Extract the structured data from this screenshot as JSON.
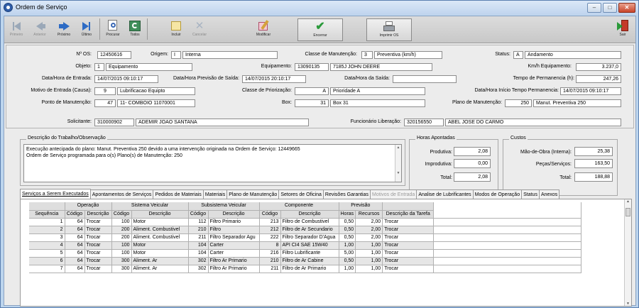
{
  "window": {
    "title": "Ordem de Serviço"
  },
  "toolbar": {
    "primeiro": "Primeiro",
    "anterior": "Anterior",
    "proximo": "Próximo",
    "ultimo": "Último",
    "procurar": "Procurar",
    "todos": "Todos",
    "incluir": "Incluir",
    "cancelar": "Cancelar",
    "modificar": "Modificar",
    "encerrar": "Encerrar",
    "imprimir": "Imprimir OS",
    "sair": "Sair"
  },
  "form": {
    "nos_label": "Nº OS:",
    "nos": "12450616",
    "origem_label": "Origem:",
    "origem_code": "I",
    "origem": "Interna",
    "classe_label": "Classe de Manutenção:",
    "classe_code": "3",
    "classe": "Preventiva (km/h)",
    "status_label": "Status:",
    "status_code": "A",
    "status": "Andamento",
    "objeto_label": "Objeto:",
    "objeto_code": "1",
    "objeto": "Equipamento",
    "equip_label": "Equipamento:",
    "equip_code": "13090135",
    "equip": "7185J JOHN DEERE",
    "kmh_label": "Km/h Equipamento:",
    "kmh": "3.237,0",
    "dhent_label": "Data/Hora de Entrada:",
    "dhent": "14/07/2015 09:10:17",
    "dhprev_label": "Data/Hora Previsão de Saída:",
    "dhprev": "14/07/2015 20:10:17",
    "dhsai_label": "Data/Hora da Saída:",
    "dhsai": "",
    "tperm_label": "Tempo de Permanencia (h):",
    "tperm": "247,26",
    "motivo_label": "Motivo de Entrada (Causa):",
    "motivo_code": "9",
    "motivo": "Lubrificacao Equipto",
    "prior_label": "Classe de Priorização:",
    "prior_code": "A",
    "prior": "Prioridade A",
    "dhini_label": "Data/Hora Início Tempo Permanencia:",
    "dhini": "14/07/2015 09:10:17",
    "ponto_label": "Ponto de Manutenção:",
    "ponto_code": "47",
    "ponto": "11- COMBOIO 11070001",
    "box_label": "Box:",
    "box_code": "31",
    "box": "Box 31",
    "plano_label": "Plano de Manutenção:",
    "plano_code": "250",
    "plano": "Manut. Preventiva 250",
    "solic_label": "Solicitante:",
    "solic_code": "310000902",
    "solic": "ADEMIR JOAO SANTANA",
    "func_label": "Funcionário Liberação:",
    "func_code": "320156550",
    "func": "ABEL JOSE DO CARMO"
  },
  "descricao": {
    "title": "Descrição do Trabalho/Observação",
    "line1": "Execução antecipada do plano: Manut. Preventiva 250 devido a uma intervenção originada na Ordem de Serviço: 12449665",
    "line2": "Ordem de Serviço programada para o(s) Plano(s) de Manutenção: 250"
  },
  "horas": {
    "title": "Horas Apontadas",
    "produtiva_label": "Produtiva:",
    "produtiva": "2,08",
    "improdutiva_label": "Improdutiva:",
    "improdutiva": "0,00",
    "total_label": "Total:",
    "total": "2,08"
  },
  "custos": {
    "title": "Custos",
    "mao_label": "Mão-de-Obra (Interna):",
    "mao": "25,38",
    "pecas_label": "Peças/Serviços:",
    "pecas": "163,50",
    "total_label": "Total:",
    "total": "188,88"
  },
  "tabs": [
    "Serviços a Serem Executados",
    "Apontamentos de Serviços",
    "Pedidos de Materiais",
    "Materiais",
    "Plano de Manutenção",
    "Setores de Oficina",
    "Revisões Garantias",
    "Motivos de Entrada",
    "Analise de Lubrificantes",
    "Modos de Operação",
    "Status",
    "Anexos"
  ],
  "grid": {
    "groups": [
      "Operação",
      "Sistema Veicular",
      "Subsistema Veicular",
      "Componente",
      "Previsão"
    ],
    "headers": [
      "Sequência",
      "Código",
      "Descrição",
      "Código",
      "Descrição",
      "Código",
      "Descrição",
      "Código",
      "Descrição",
      "Horas",
      "Recursos",
      "Descrição da Tarefa"
    ],
    "rows": [
      [
        "1",
        "64",
        "Trocar",
        "100",
        "Motor",
        "112",
        "Filtro Primario",
        "213",
        "Filtro de Combustivel",
        "0,50",
        "2,00",
        "Trocar"
      ],
      [
        "2",
        "64",
        "Trocar",
        "200",
        "Aliment. Combustivel",
        "210",
        "Filtro",
        "212",
        "Filtro de Ar Secundario",
        "0,50",
        "2,00",
        "Trocar"
      ],
      [
        "3",
        "64",
        "Trocar",
        "200",
        "Aliment. Combustivel",
        "211",
        "Filtro Separador Agu",
        "222",
        "Filtro Separador D'Agua",
        "0,50",
        "2,00",
        "Trocar"
      ],
      [
        "4",
        "64",
        "Trocar",
        "100",
        "Motor",
        "104",
        "Carter",
        "8",
        "API CI4 SAE 15W40",
        "1,00",
        "1,00",
        "Trocar"
      ],
      [
        "5",
        "64",
        "Trocar",
        "100",
        "Motor",
        "104",
        "Carter",
        "216",
        "Filtro Lubrificante",
        "5,00",
        "1,00",
        "Trocar"
      ],
      [
        "6",
        "64",
        "Trocar",
        "300",
        "Aliment. Ar",
        "302",
        "Filtro Ar Primario",
        "210",
        "Filtro de Ar Cabine",
        "0,50",
        "1,00",
        "Trocar"
      ],
      [
        "7",
        "64",
        "Trocar",
        "300",
        "Aliment. Ar",
        "302",
        "Filtro Ar Primario",
        "211",
        "Filtro de Ar Primario",
        "1,00",
        "1,00",
        "Trocar"
      ]
    ]
  }
}
